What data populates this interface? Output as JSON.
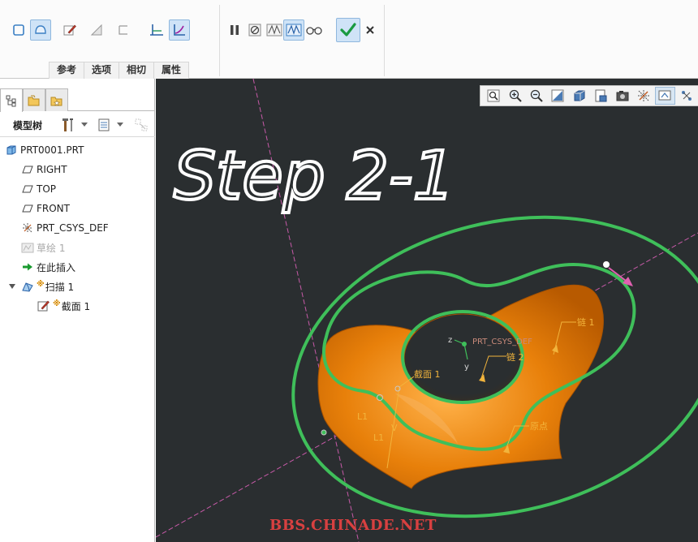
{
  "ribbon": {
    "tabs": [
      "参考",
      "选项",
      "相切",
      "属性"
    ]
  },
  "model_tree": {
    "title": "模型树",
    "items": [
      {
        "label": "PRT0001.PRT",
        "icon": "part-icon"
      },
      {
        "label": "RIGHT",
        "icon": "datum-plane-icon"
      },
      {
        "label": "TOP",
        "icon": "datum-plane-icon"
      },
      {
        "label": "FRONT",
        "icon": "datum-plane-icon"
      },
      {
        "label": "PRT_CSYS_DEF",
        "icon": "csys-icon"
      },
      {
        "label": "草绘 1",
        "icon": "sketch-icon"
      },
      {
        "label": "在此插入",
        "icon": "insert-here-arrow-icon"
      },
      {
        "label": "扫描 1",
        "icon": "sweep-icon"
      },
      {
        "label": "截面 1",
        "icon": "section-icon"
      }
    ]
  },
  "viewport": {
    "handwriting": "Step 2-1",
    "csys_label": "PRT_CSYS_DEF",
    "axis_labels": {
      "z": "z",
      "y": "y"
    },
    "annotations": {
      "chain1": "链 1",
      "chain2": "链 2",
      "section1": "截面 1",
      "origin": "原点",
      "l1_a": "L1",
      "l1_b": "L1",
      "v": "V"
    },
    "watermark": "BBS.CHINADE.NET"
  },
  "colors": {
    "viewport_bg": "#2a2e30",
    "surface": "#e8800a",
    "trajectory": "#3fbf5a",
    "annotation": "#f2b43c",
    "watermark": "#d84040",
    "confirm": "#1a9a40"
  }
}
